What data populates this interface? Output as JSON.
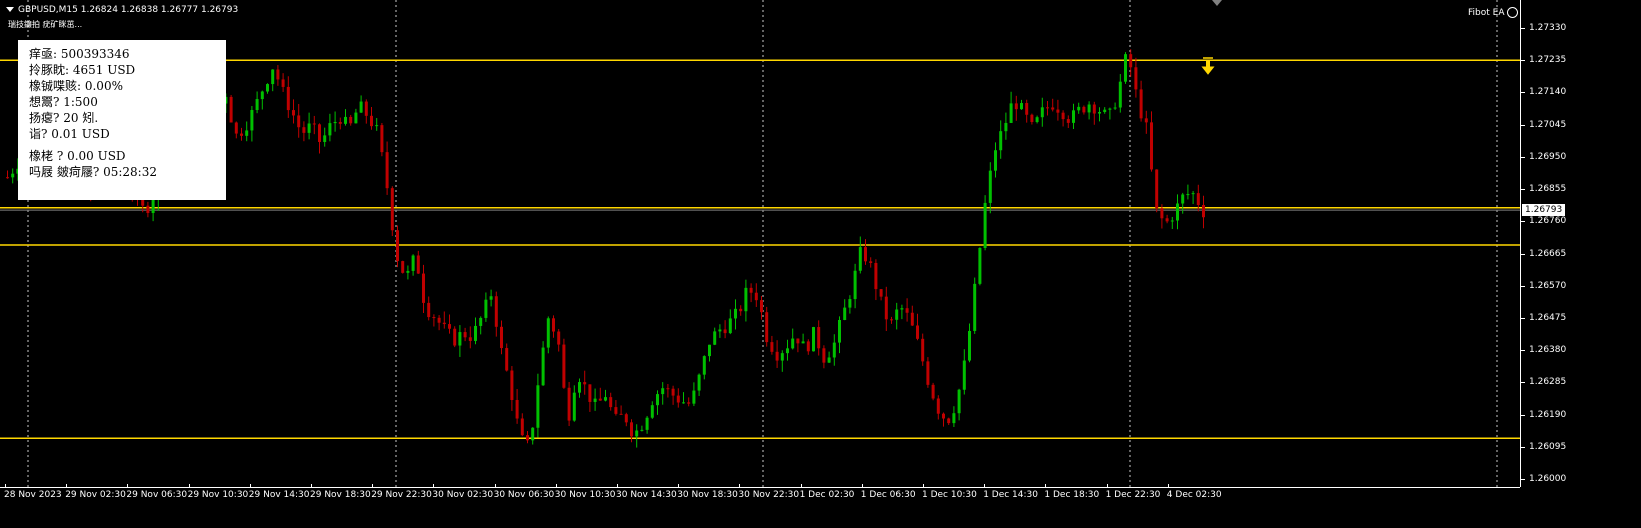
{
  "header": {
    "symbol_line": "GBPUSD,M15  1.26824 1.26838 1.26777 1.26793",
    "subline": "瑞技鐮拍 疣矿眯茁..."
  },
  "expert": {
    "label": "Fibot EA",
    "icon": "smiley-icon"
  },
  "info_panel": {
    "account": "痒亟: 500393346",
    "balance": "拎豚眈: 4651 USD",
    "drawdown": "橡铖喋赅: 0.00%",
    "leverage": "想鬻? 1:500",
    "spread": "扬瘪? 20 矧.",
    "lot": "诣? 0.01 USD",
    "profit": "橡栳     ? 0.00 USD",
    "time_left": "吗屐     皴疴屦? 05:28:32"
  },
  "current_price": "1.26793",
  "colors": {
    "background": "#000000",
    "bull": "#00c000",
    "bear": "#c00000",
    "level": "#ffd700",
    "arrow": "#ffd700",
    "grid": "#c8c8c8"
  },
  "price_axis": {
    "ticks": [
      "1.27330",
      "1.27235",
      "1.27140",
      "1.27045",
      "1.26950",
      "1.26855",
      "1.26760",
      "1.26665",
      "1.26570",
      "1.26475",
      "1.26380",
      "1.26285",
      "1.26190",
      "1.26095",
      "1.26000"
    ]
  },
  "time_axis": {
    "labels": [
      "28 Nov 2023",
      "29 Nov 02:30",
      "29 Nov 06:30",
      "29 Nov 10:30",
      "29 Nov 14:30",
      "29 Nov 18:30",
      "29 Nov 22:30",
      "30 Nov 02:30",
      "30 Nov 06:30",
      "30 Nov 10:30",
      "30 Nov 14:30",
      "30 Nov 18:30",
      "30 Nov 22:30",
      "1 Dec 02:30",
      "1 Dec 06:30",
      "1 Dec 10:30",
      "1 Dec 14:30",
      "1 Dec 18:30",
      "1 Dec 22:30",
      "4 Dec 02:30"
    ]
  },
  "levels": [
    1.27235,
    1.268,
    1.2669,
    1.2612
  ],
  "signal": {
    "type": "sell-arrow",
    "icon": "down-arrow-icon"
  },
  "chart_data": {
    "type": "candlestick",
    "symbol": "GBPUSD",
    "timeframe": "M15",
    "ylim": [
      1.26,
      1.2735
    ],
    "last": {
      "open": 1.26824,
      "high": 1.26838,
      "low": 1.26777,
      "close": 1.26793
    },
    "close_path": [
      1.2689,
      1.2693,
      1.2697,
      1.2694,
      1.269,
      1.2686,
      1.2689,
      1.2686,
      1.2691,
      1.2682,
      1.2686,
      1.2694,
      1.2698,
      1.2687,
      1.2679,
      1.2681,
      1.2689,
      1.2697,
      1.2701,
      1.2706,
      1.2704,
      1.2699,
      1.2708,
      1.2714,
      1.2701,
      1.2704,
      1.2709,
      1.2716,
      1.2722,
      1.2714,
      1.2708,
      1.2702,
      1.2704,
      1.2699,
      1.2704,
      1.2707,
      1.2703,
      1.271,
      1.2707,
      1.2702,
      1.2686,
      1.2666,
      1.2659,
      1.2666,
      1.2651,
      1.2648,
      1.2644,
      1.2641,
      1.2643,
      1.2642,
      1.2648,
      1.2655,
      1.2638,
      1.2627,
      1.2612,
      1.2609,
      1.2631,
      1.2648,
      1.2641,
      1.2617,
      1.2632,
      1.2626,
      1.2621,
      1.2625,
      1.2617,
      1.2619,
      1.2613,
      1.2617,
      1.2624,
      1.2627,
      1.2625,
      1.2623,
      1.2622,
      1.2631,
      1.2641,
      1.2644,
      1.2646,
      1.2649,
      1.2656,
      1.2654,
      1.2642,
      1.2637,
      1.2639,
      1.2643,
      1.2638,
      1.2643,
      1.2636,
      1.2639,
      1.2648,
      1.2657,
      1.2668,
      1.2662,
      1.2652,
      1.2645,
      1.2651,
      1.2647,
      1.2639,
      1.2629,
      1.2621,
      1.2617,
      1.2623,
      1.2636,
      1.2658,
      1.2681,
      1.2697,
      1.2704,
      1.2712,
      1.2708,
      1.2703,
      1.2708,
      1.2711,
      1.2709,
      1.2706,
      1.2709,
      1.2711,
      1.2709,
      1.2706,
      1.2714,
      1.2726,
      1.2712,
      1.2703,
      1.2679,
      1.2675,
      1.2679,
      1.2684,
      1.2684,
      1.2679
    ]
  }
}
